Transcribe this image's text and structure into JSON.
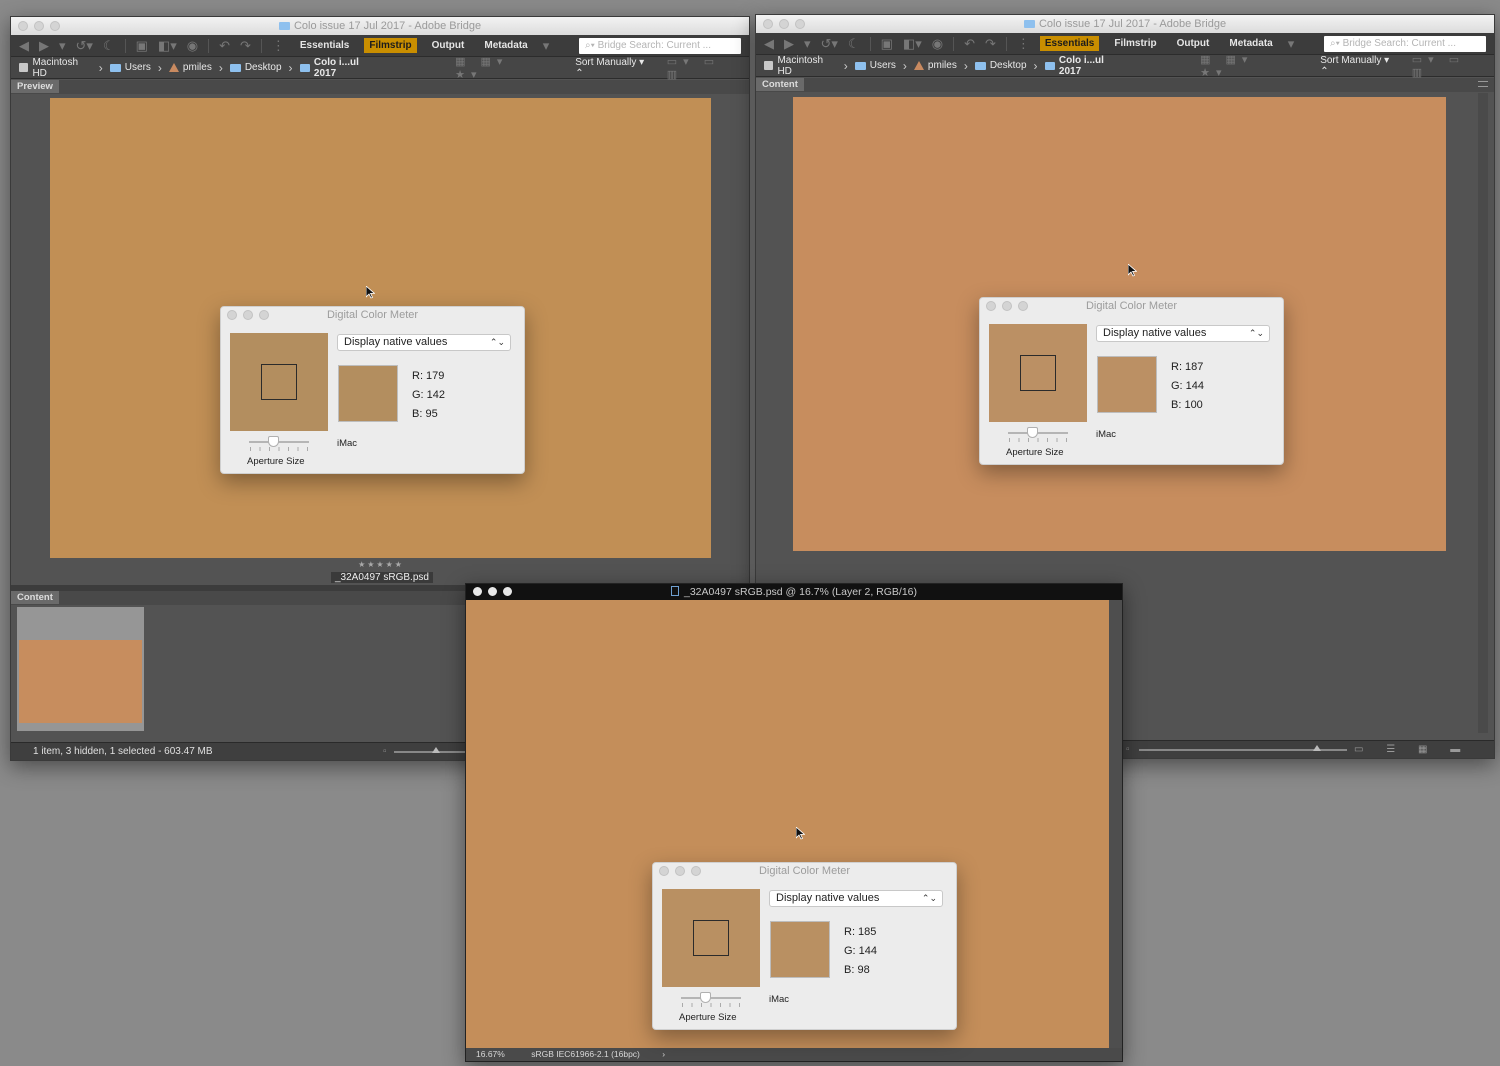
{
  "bridge": {
    "title": "Colo issue 17 Jul 2017 - Adobe Bridge",
    "workspaces": {
      "essentials": "Essentials",
      "filmstrip": "Filmstrip",
      "output": "Output",
      "metadata": "Metadata"
    },
    "search_placeholder": "Bridge Search: Current ...",
    "breadcrumbs": [
      "Macintosh HD",
      "Users",
      "pmiles",
      "Desktop",
      "Colo i...ul 2017"
    ],
    "sort_label": "Sort Manually",
    "preview_tab": "Preview",
    "content_tab": "Content",
    "file_name": "_32A0497 sRGB.psd",
    "rating_stars": "★★★★★",
    "status_text": "1 item, 3 hidden, 1 selected - 603.47 MB"
  },
  "photoshop": {
    "title": "_32A0497 sRGB.psd @ 16.7% (Layer 2, RGB/16)",
    "zoom": "16.67%",
    "profile": "sRGB IEC61966-2.1 (16bpc)",
    "arrow": "›"
  },
  "color_meters": [
    {
      "title": "Digital Color Meter",
      "mode": "Display native values",
      "r": "R: 179",
      "g": "G: 142",
      "b": "B: 95",
      "display": "iMac",
      "aperture_label": "Aperture Size",
      "color": "#b38e5f"
    },
    {
      "title": "Digital Color Meter",
      "mode": "Display native values",
      "r": "R: 187",
      "g": "G: 144",
      "b": "B: 100",
      "display": "iMac",
      "aperture_label": "Aperture Size",
      "color": "#bb9064"
    },
    {
      "title": "Digital Color Meter",
      "mode": "Display native values",
      "r": "R: 185",
      "g": "G: 144",
      "b": "B: 98",
      "display": "iMac",
      "aperture_label": "Aperture Size",
      "color": "#b99062"
    }
  ],
  "colors": {
    "preview_left": "#c18f55",
    "preview_right": "#c78d5e",
    "preview_ps": "#c48e5a",
    "thumb": "#c78d5e",
    "accent": "#c98e00"
  }
}
